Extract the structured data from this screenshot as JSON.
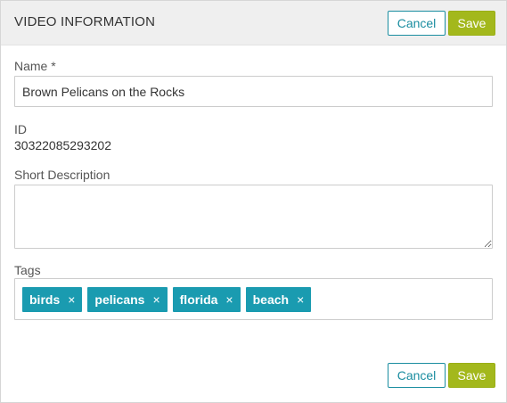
{
  "header": {
    "title": "VIDEO INFORMATION",
    "cancel_label": "Cancel",
    "save_label": "Save"
  },
  "form": {
    "name": {
      "label": "Name *",
      "value": "Brown Pelicans on the Rocks"
    },
    "id": {
      "label": "ID",
      "value": "30322085293202"
    },
    "short_description": {
      "label": "Short Description",
      "value": ""
    },
    "tags": {
      "label": "Tags",
      "items": [
        {
          "label": "birds",
          "remove": "×"
        },
        {
          "label": "pelicans",
          "remove": "×"
        },
        {
          "label": "florida",
          "remove": "×"
        },
        {
          "label": "beach",
          "remove": "×"
        }
      ]
    }
  },
  "footer": {
    "cancel_label": "Cancel",
    "save_label": "Save"
  },
  "colors": {
    "accent": "#1a8da0",
    "tag_background": "#1a9bb0",
    "save_background": "#a3b81c",
    "header_background": "#efefef"
  }
}
